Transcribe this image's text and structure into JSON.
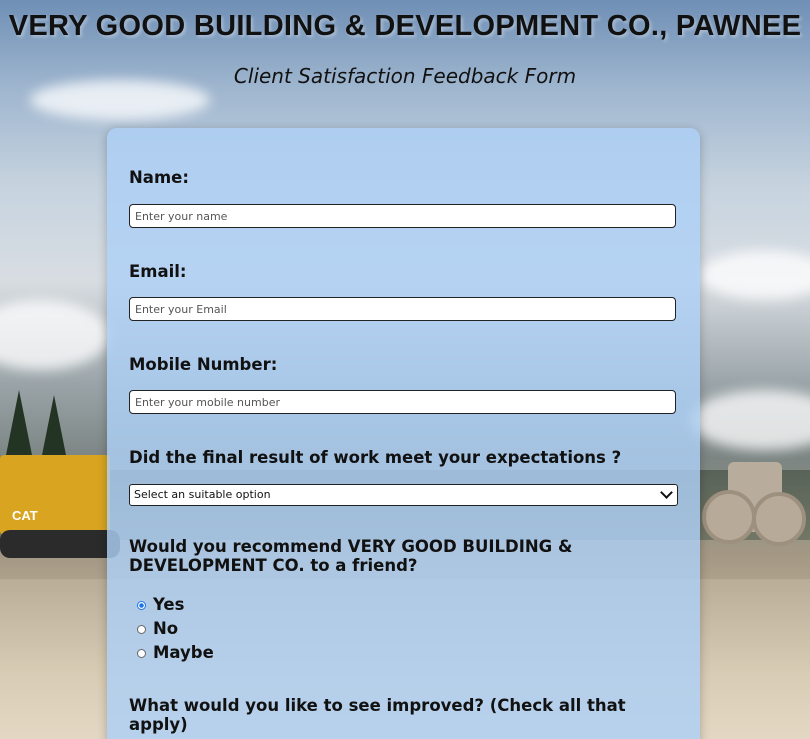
{
  "header": {
    "company_title": "VERY GOOD BUILDING & DEVELOPMENT CO., PAWNEE",
    "form_subtitle": "Client Satisfaction Feedback Form"
  },
  "form": {
    "name": {
      "label": "Name:",
      "placeholder": "Enter your name",
      "value": ""
    },
    "email": {
      "label": "Email:",
      "placeholder": "Enter your Email",
      "value": ""
    },
    "mobile": {
      "label": "Mobile Number:",
      "placeholder": "Enter your mobile number",
      "value": ""
    },
    "expectations": {
      "question": "Did the final result of work meet your expectations ?",
      "selected": "Select an suitable option"
    },
    "recommend": {
      "question": "Would you recommend VERY GOOD BUILDING & DEVELOPMENT CO. to a friend?",
      "options": [
        "Yes",
        "No",
        "Maybe"
      ],
      "selected": "Yes"
    },
    "improve": {
      "question": "What would you like to see improved? (Check all that apply)"
    }
  },
  "background": {
    "machine_text": "CAT"
  },
  "colors": {
    "card_background": "#add0f5",
    "radio_accent": "#1a73e8",
    "text": "#111111"
  },
  "icons": {
    "select_arrow": "chevron-down-icon"
  }
}
